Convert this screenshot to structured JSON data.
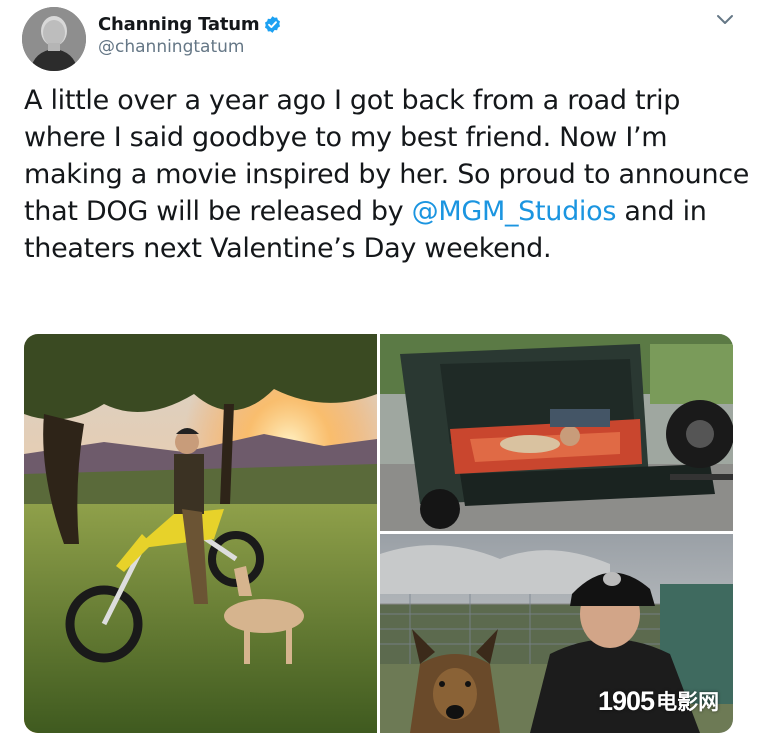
{
  "author": {
    "display_name": "Channing Tatum",
    "handle": "@channingtatum",
    "verified": true
  },
  "tweet": {
    "text_before": "A little over a year ago I got back from a road trip where I said goodbye to my best friend. Now I’m making a movie inspired by her. So proud to announce that DOG will be released by ",
    "mention": "@MGM_Studios",
    "text_after": " and in theaters next Valentine’s Day weekend."
  },
  "media": {
    "photos": [
      {
        "subject": "man on dirt bike with dog at sunset"
      },
      {
        "subject": "man and dog resting in back of truck"
      },
      {
        "subject": "man in cap with shepherd dog"
      }
    ]
  },
  "watermark": {
    "number": "1905",
    "chinese": "电影网"
  },
  "colors": {
    "link": "#1b95e0",
    "verified": "#1da1f2",
    "secondary_text": "#657786"
  },
  "icons": [
    "verified-badge-icon",
    "chevron-down-icon"
  ]
}
